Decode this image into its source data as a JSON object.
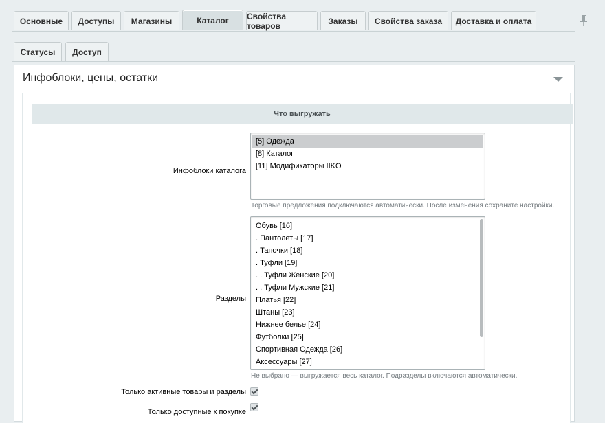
{
  "tabs": [
    {
      "label": "Основные",
      "active": false
    },
    {
      "label": "Доступы",
      "active": false
    },
    {
      "label": "Магазины",
      "active": false
    },
    {
      "label": "Каталог",
      "active": true
    },
    {
      "label": "Свойства товаров",
      "active": false
    },
    {
      "label": "Заказы",
      "active": false
    },
    {
      "label": "Свойства заказа",
      "active": false
    },
    {
      "label": "Доставка и оплата",
      "active": false
    }
  ],
  "subtabs": [
    {
      "label": "Статусы"
    },
    {
      "label": "Доступ"
    }
  ],
  "section": {
    "title": "Инфоблоки, цены, остатки",
    "heading": "Что выгружать"
  },
  "iblocks": {
    "label": "Инфоблоки каталога",
    "options": [
      "[5] Одежда",
      "[8] Каталог",
      "[11] Модификаторы IIKO"
    ],
    "selected_index": 0,
    "hint": "Торговые предложения подключаются автоматически. После изменения сохраните настройки."
  },
  "sections": {
    "label": "Разделы",
    "options": [
      "Обувь [16]",
      ". Пантолеты [17]",
      ". Тапочки [18]",
      ". Туфли [19]",
      ". . Туфли Женские [20]",
      ". . Туфли Мужские [21]",
      "Платья [22]",
      "Штаны [23]",
      "Нижнее белье [24]",
      "Футболки [25]",
      "Спортивная Одежда [26]",
      "Аксессуары [27]"
    ],
    "hint": "Не выбрано — выгружается весь каталог. Подразделы включаются автоматически."
  },
  "checkboxes": [
    {
      "label": "Только активные товары и разделы",
      "checked": true
    },
    {
      "label": "Только доступные к покупке",
      "checked": true
    }
  ],
  "colors": {
    "background": "#e9eef0",
    "tab": "#eef2f3",
    "tab_active": "#d8e0e2",
    "heading_bar": "#e0e8ea"
  },
  "icons": {
    "pin": "pin-icon",
    "collapse": "triangle-down-icon"
  }
}
